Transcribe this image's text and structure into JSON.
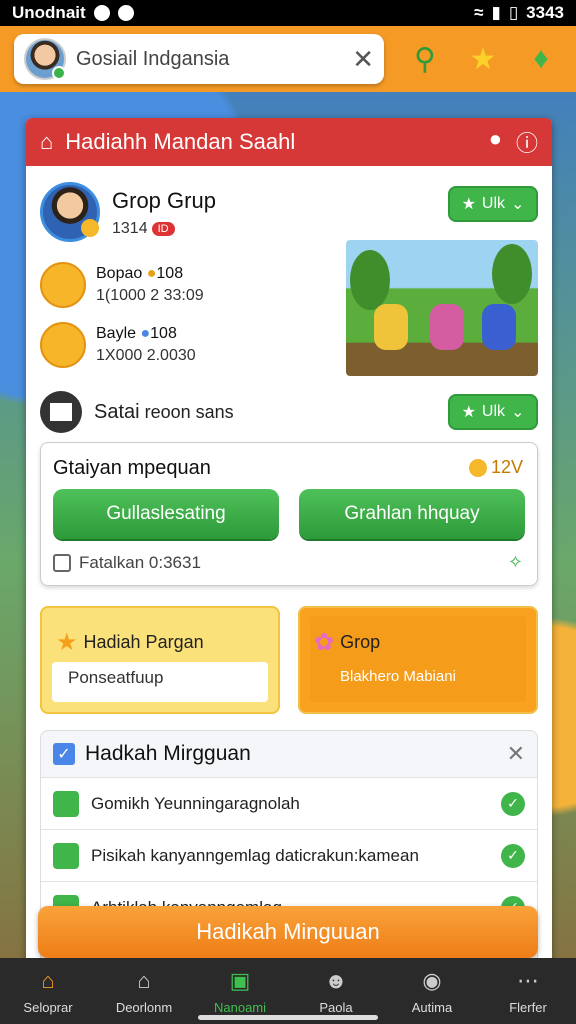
{
  "status_bar": {
    "carrier": "Unodnait",
    "time": "3343"
  },
  "top_bar": {
    "search_text": "Gosiail Indgansia"
  },
  "panel": {
    "title": "Hadiahh Mandan Saahl",
    "group": {
      "title": "Grop Grup",
      "sub": "1314",
      "badge": "ID",
      "join_label": "Ulk"
    },
    "members": [
      {
        "name": "Bopao",
        "coins": "108",
        "stats": "1(1000 2 33:09"
      },
      {
        "name": "Bayle",
        "coins": "108",
        "stats": "1X000 2.0030"
      }
    ],
    "satai": {
      "name": "Satai",
      "desc": "reoon sans",
      "button": "Ulk"
    },
    "mission": {
      "title": "Gtaiyan mpequan",
      "reward": "12V",
      "btn_left": "Gullaslesating",
      "btn_right": "Grahlan hhquay",
      "footer": "Fatalkan 0:3631"
    },
    "card_left": {
      "title": "Hadiah Pargan",
      "sub": "Ponseatfuup"
    },
    "card_right": {
      "title": "Grop",
      "sub": "Blakhero Mabiani"
    },
    "weekly": {
      "title": "Hadkah Mirgguan",
      "tasks": [
        "Gomikh Yeunningaragnolah",
        "Pisikah kanyanngemlag daticrakun:kamean",
        "Arhtiklah kanyanngemlag"
      ]
    }
  },
  "cta": {
    "label": "Hadikah Minguuan"
  },
  "bottom_nav": [
    {
      "label": "Seloprar",
      "icon": "home-icon"
    },
    {
      "label": "Deorlonm",
      "icon": "house-icon"
    },
    {
      "label": "Nanoami",
      "icon": "gift-icon"
    },
    {
      "label": "Paola",
      "icon": "person-icon"
    },
    {
      "label": "Autima",
      "icon": "game-icon"
    },
    {
      "label": "Flerfer",
      "icon": "more-icon"
    }
  ],
  "colors": {
    "accent": "#f59a25",
    "header": "#d63838",
    "green": "#3fb54a"
  }
}
